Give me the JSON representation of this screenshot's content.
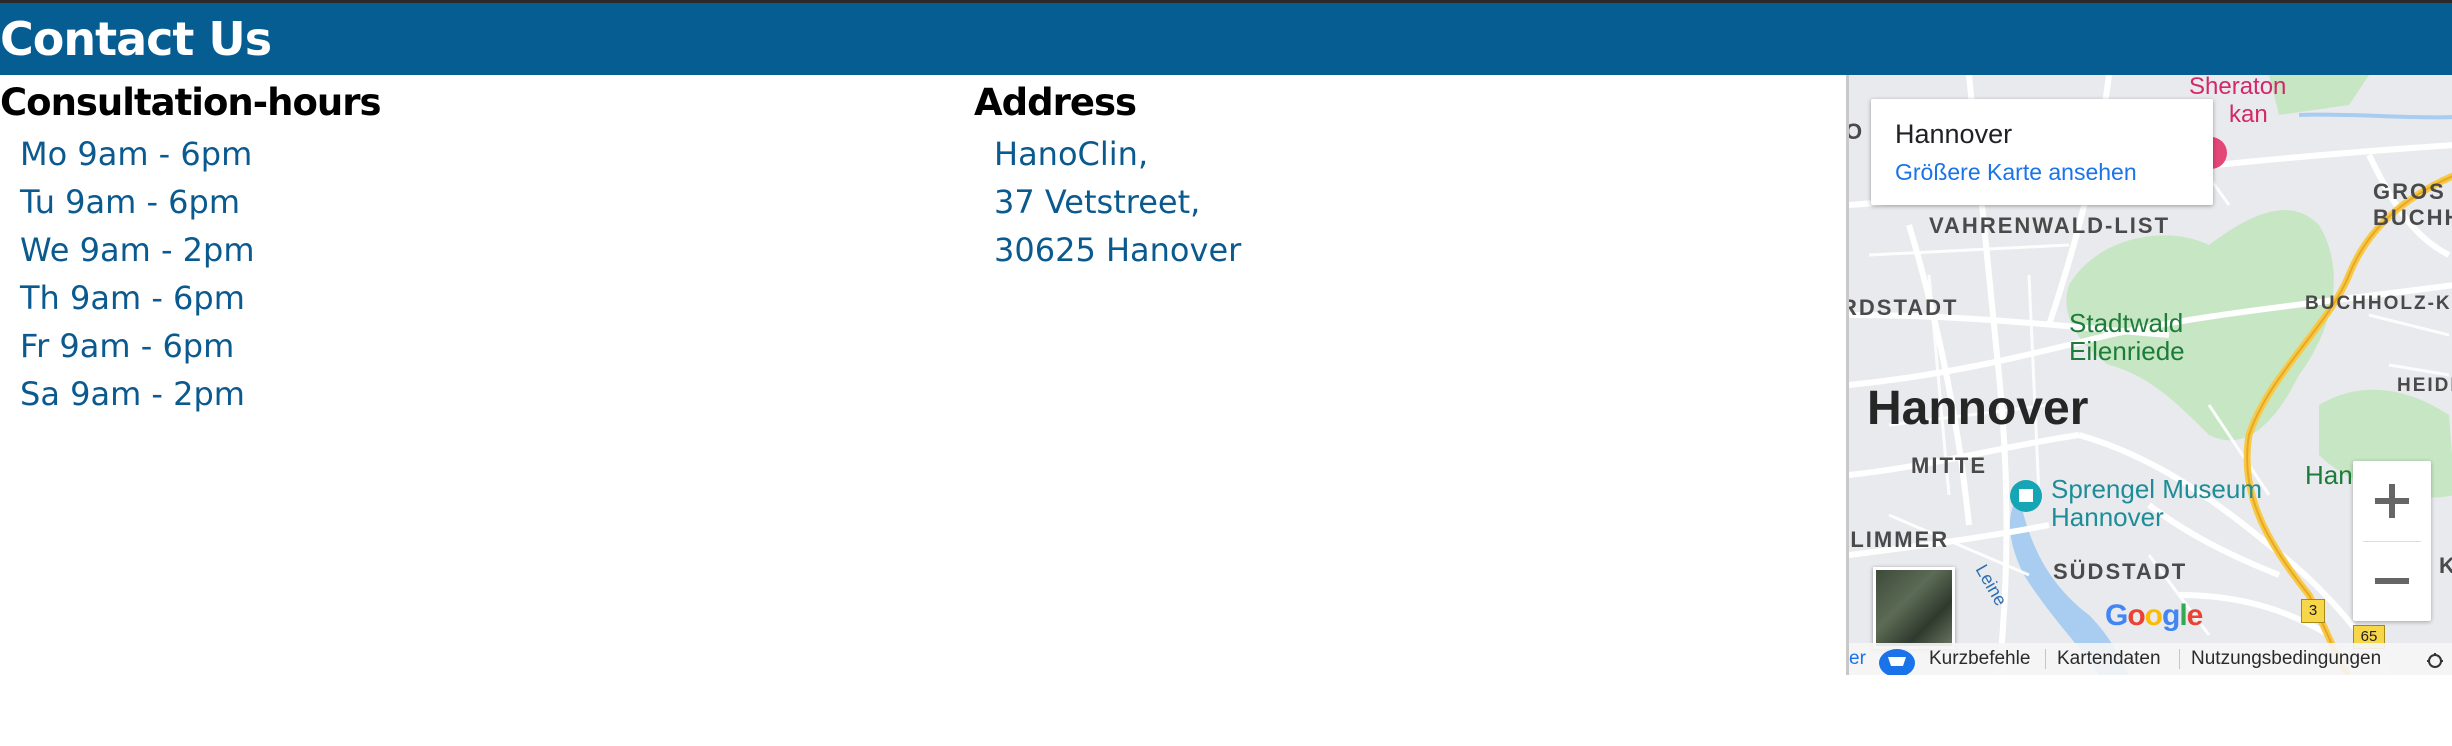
{
  "header": {
    "title": "Contact Us"
  },
  "consultation": {
    "title": "Consultation-hours",
    "hours": [
      "Mo 9am - 6pm",
      "Tu 9am - 6pm",
      "We 9am - 2pm",
      "Th 9am - 6pm",
      "Fr 9am - 6pm",
      "Sa 9am - 2pm"
    ]
  },
  "address": {
    "title": "Address",
    "lines": [
      "HanoClin,",
      "37 Vetstreet,",
      "30625 Hanover"
    ]
  },
  "map": {
    "card_title": "Hannover",
    "card_link": "Größere Karte ansehen",
    "city": "Hannover",
    "districts": {
      "vahrenwald": "VAHRENWALD-LIST",
      "nordstadt": "RDSTADT",
      "mitte": "MITTE",
      "linden": "-LIMMER",
      "suedstadt": "SÜDSTADT",
      "gross": "GROS",
      "buchh": "BUCHH",
      "buchholz": "BUCHHOLZ-KLI",
      "heide": "HEIDE",
      "k": "K",
      "o": "O"
    },
    "park": [
      "Stadtwald",
      "Eilenriede"
    ],
    "poi_museum": [
      "Sprengel Museum",
      "Hannover"
    ],
    "poi_sheraton": [
      "Sheraton",
      "kan"
    ],
    "poi_han": "Han",
    "river": "Leine",
    "road_3": "3",
    "road_65": "65",
    "google": [
      "G",
      "o",
      "o",
      "g",
      "l",
      "e"
    ],
    "footer": {
      "er": "er",
      "shortcuts": "Kurzbefehle",
      "mapdata": "Kartendaten",
      "terms": "Nutzungsbedingungen"
    },
    "colors": {
      "park": "#c7e6c4",
      "road": "#ffffff",
      "highway": "#f7c948",
      "water": "#a8cdf0"
    }
  }
}
